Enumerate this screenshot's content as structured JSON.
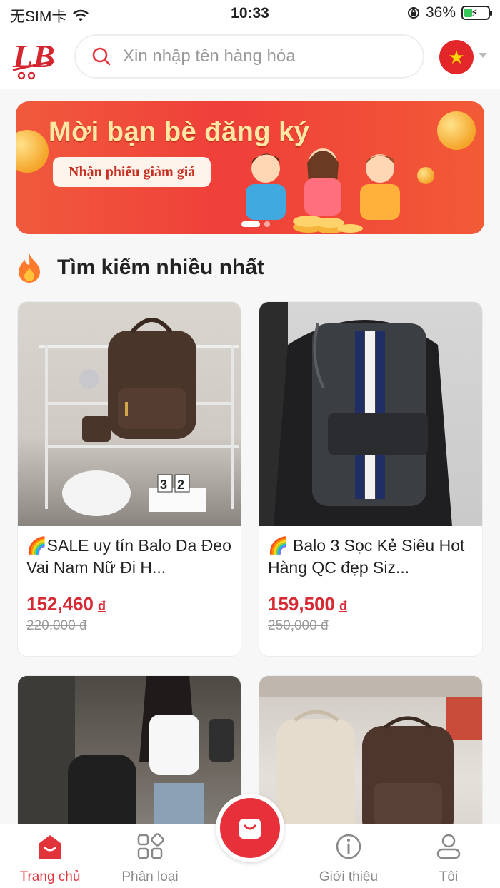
{
  "status_bar": {
    "carrier": "无SIM卡",
    "time": "10:33",
    "battery": "36%",
    "battery_level": 0.36
  },
  "header": {
    "search_placeholder": "Xin nhập tên hàng hóa",
    "language_flag": "vietnam-flag"
  },
  "banner": {
    "title": "Mời bạn bè đăng ký",
    "subtitle": "Nhận phiếu giảm giá",
    "slide_count": 2,
    "active_slide": 1
  },
  "section": {
    "title": "Tìm kiếm nhiều nhất"
  },
  "products": [
    {
      "name": "🌈SALE uy tín Balo Da Đeo Vai Nam Nữ Đi H...",
      "price": "152,460",
      "currency": "đ",
      "old_price": "220,000 đ"
    },
    {
      "name": "🌈 Balo 3 Sọc Kẻ Siêu Hot Hàng QC đẹp Siz...",
      "price": "159,500",
      "currency": "đ",
      "old_price": "250,000 đ"
    },
    {
      "name": "",
      "price": "",
      "currency": "",
      "old_price": ""
    },
    {
      "name": "",
      "price": "",
      "currency": "",
      "old_price": ""
    }
  ],
  "nav": {
    "items": [
      {
        "label": "Trang chủ",
        "icon": "home-icon",
        "active": true
      },
      {
        "label": "Phân loại",
        "icon": "category-icon",
        "active": false
      },
      {
        "label": "Giới thiệu",
        "icon": "info-icon",
        "active": false
      },
      {
        "label": "Tôi",
        "icon": "user-icon",
        "active": false
      }
    ],
    "center_icon": "shopping-bag-icon"
  },
  "colors": {
    "accent": "#e2323a",
    "price": "#d62b34",
    "banner": "#ef3f3a"
  }
}
